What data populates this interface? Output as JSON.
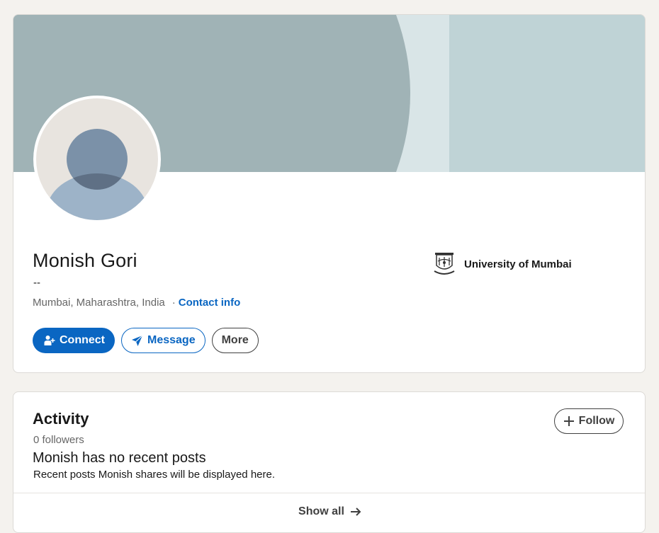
{
  "profile": {
    "name": "Monish Gori",
    "headline": "--",
    "location": "Mumbai, Maharashtra, India",
    "separator": "·",
    "contact_info_label": "Contact info",
    "school": {
      "name": "University of Mumbai",
      "icon": "university-crest-icon"
    }
  },
  "actions": {
    "connect_label": "Connect",
    "message_label": "Message",
    "more_label": "More"
  },
  "activity": {
    "title": "Activity",
    "followers": "0 followers",
    "follow_label": "Follow",
    "empty_title": "Monish has no recent posts",
    "empty_desc": "Recent posts Monish shares will be displayed here.",
    "show_all_label": "Show all"
  },
  "colors": {
    "accent": "#0a66c2",
    "banner_gray": "#a0b3b6",
    "banner_light": "#d9e5e7",
    "banner_blue": "#bfd3d6",
    "page_bg": "#f4f2ee"
  }
}
